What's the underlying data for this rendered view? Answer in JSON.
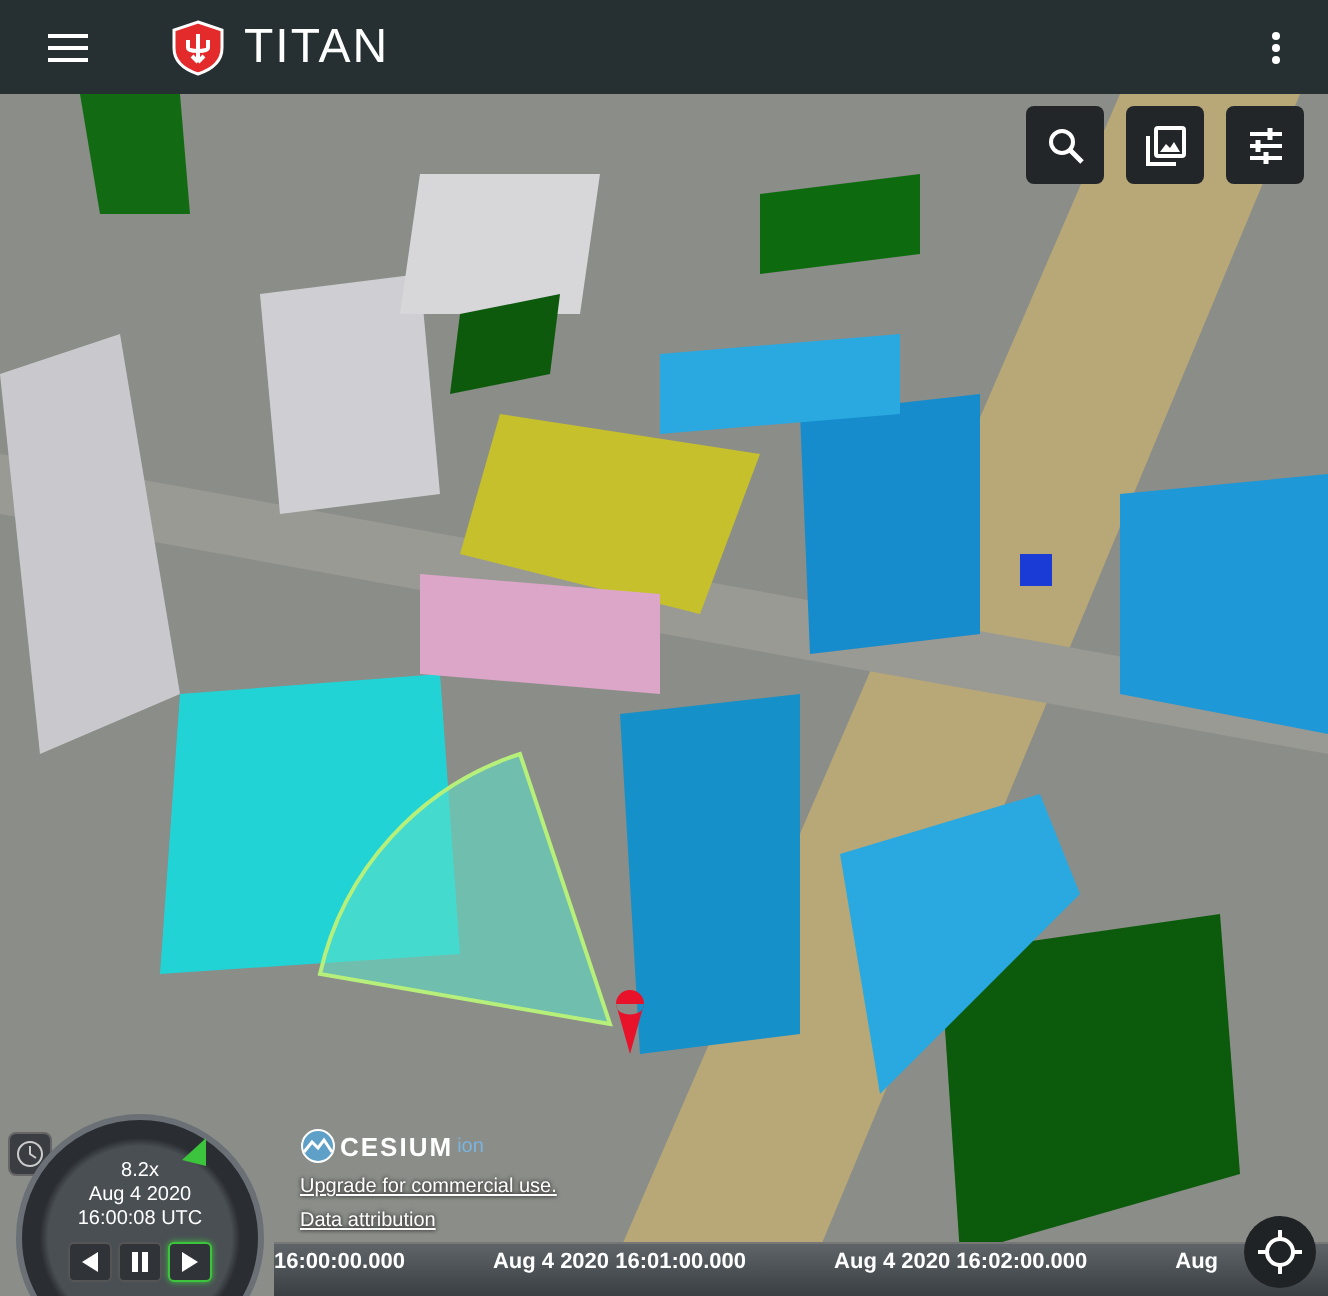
{
  "app": {
    "title": "TITAN"
  },
  "credits": {
    "logo_text": "CESIUM",
    "logo_suffix": "ion",
    "upgrade_link": "Upgrade for commercial use.",
    "attribution_link": "Data attribution"
  },
  "animation": {
    "speed": "8.2x",
    "date": "Aug 4 2020",
    "time": "16:00:08 UTC",
    "buttons": [
      {
        "kind": "reverse",
        "selected": false
      },
      {
        "kind": "pause",
        "selected": false
      },
      {
        "kind": "play",
        "selected": true
      }
    ]
  },
  "timeline": {
    "labels": [
      "16:00:00.000",
      "Aug 4 2020 16:01:00.000",
      "Aug 4 2020 16:02:00.000",
      "Aug"
    ]
  }
}
